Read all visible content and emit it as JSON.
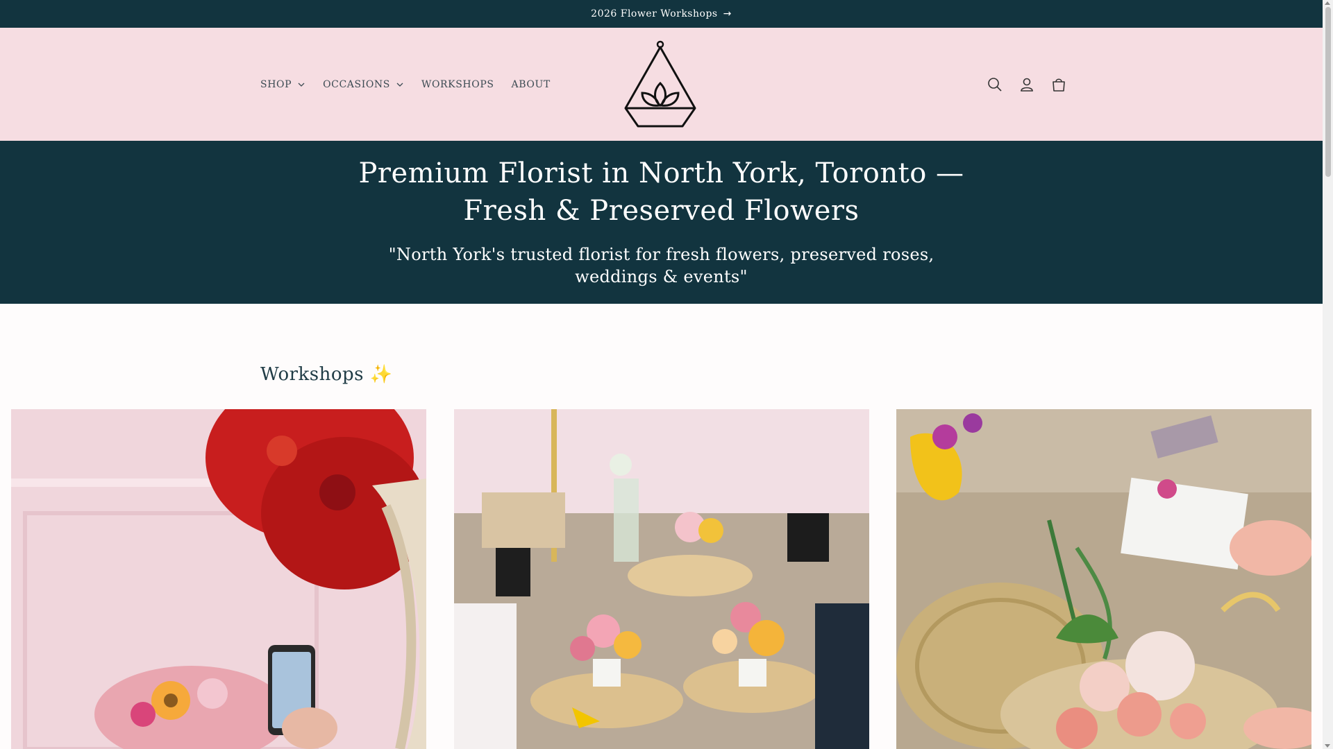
{
  "announcement": {
    "text": "2026 Flower Workshops",
    "arrow_icon": "arrow-right-icon"
  },
  "nav": {
    "items": [
      {
        "label": "SHOP",
        "has_dropdown": true
      },
      {
        "label": "OCCASIONS",
        "has_dropdown": true
      },
      {
        "label": "WORKSHOPS",
        "has_dropdown": false
      },
      {
        "label": "ABOUT",
        "has_dropdown": false
      }
    ]
  },
  "header_icons": [
    "search-icon",
    "account-icon",
    "cart-icon"
  ],
  "hero": {
    "title_line1": "Premium Florist in North York, Toronto —",
    "title_line2": "Fresh & Preserved Flowers",
    "subtitle_line1": "\"North York's trusted florist for fresh flowers, preserved roses,",
    "subtitle_line2": "weddings & events\""
  },
  "workshops": {
    "title": "Workshops",
    "title_emoji": "✨",
    "cards": [
      {
        "image": "workshop-photo-1"
      },
      {
        "image": "workshop-photo-2"
      },
      {
        "image": "workshop-photo-3"
      }
    ]
  },
  "colors": {
    "dark_teal": "#12343f",
    "pink_header": "#f6dde2",
    "page_bg": "#fefcfc"
  }
}
